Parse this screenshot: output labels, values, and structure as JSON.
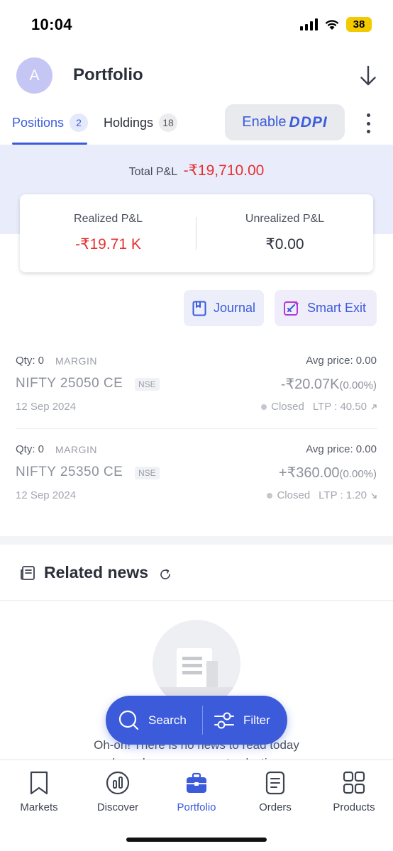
{
  "status_bar": {
    "time": "10:04",
    "battery": "38"
  },
  "header": {
    "avatar_letter": "A",
    "title": "Portfolio"
  },
  "tabs": [
    {
      "label": "Positions",
      "count": "2",
      "active": true
    },
    {
      "label": "Holdings",
      "count": "18",
      "active": false
    }
  ],
  "ddpi": {
    "enable_label": "Enable",
    "logo_text": "DDPI"
  },
  "summary": {
    "total_label": "Total P&L",
    "total_value": "-₹19,710.00",
    "realized_label": "Realized P&L",
    "realized_value": "-₹19.71 K",
    "unrealized_label": "Unrealized P&L",
    "unrealized_value": "₹0.00"
  },
  "actions": {
    "journal_label": "Journal",
    "smart_exit_label": "Smart Exit"
  },
  "positions": [
    {
      "qty": "Qty: 0",
      "product": "MARGIN",
      "avg": "Avg price: 0.00",
      "name": "NIFTY 25050 CE",
      "exchange": "NSE",
      "pnl": "-₹20.07K",
      "pnl_pct": "(0.00%)",
      "date": "12 Sep 2024",
      "status": "Closed",
      "ltp": "LTP : 40.50",
      "ltp_trend": "up"
    },
    {
      "qty": "Qty: 0",
      "product": "MARGIN",
      "avg": "Avg price: 0.00",
      "name": "NIFTY 25350 CE",
      "exchange": "NSE",
      "pnl": "+₹360.00",
      "pnl_pct": "(0.00%)",
      "date": "12 Sep 2024",
      "status": "Closed",
      "ltp": "LTP : 1.20",
      "ltp_trend": "down"
    }
  ],
  "news": {
    "title": "Related news",
    "empty_line1": "Oh-oh! There is no news to read today",
    "empty_line2": "based on your current selection"
  },
  "fab": {
    "search_label": "Search",
    "filter_label": "Filter"
  },
  "bottom_nav": [
    {
      "label": "Markets",
      "icon": "bookmark-icon"
    },
    {
      "label": "Discover",
      "icon": "discover-icon"
    },
    {
      "label": "Portfolio",
      "icon": "briefcase-icon",
      "active": true
    },
    {
      "label": "Orders",
      "icon": "orders-icon"
    },
    {
      "label": "Products",
      "icon": "grid-icon"
    }
  ],
  "colors": {
    "accent": "#3b5bdb",
    "negative": "#e5302e",
    "band": "#e9ecfb"
  }
}
